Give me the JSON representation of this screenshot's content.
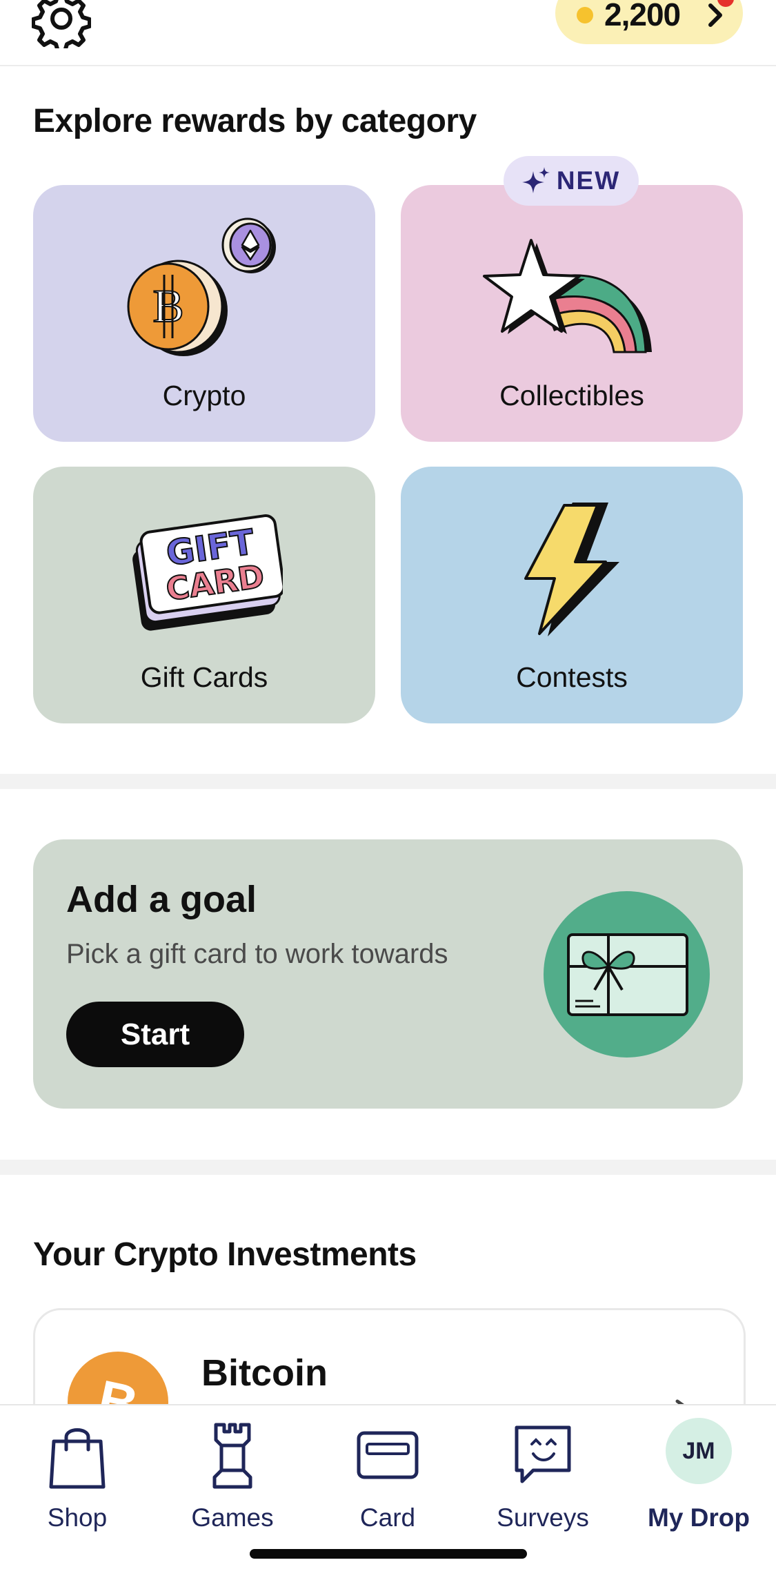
{
  "header": {
    "points": "2,200"
  },
  "categories": {
    "title": "Explore rewards by category",
    "new_badge": "NEW",
    "items": [
      {
        "label": "Crypto",
        "color": "#d4d3ec",
        "icon": "crypto-coins-icon"
      },
      {
        "label": "Collectibles",
        "color": "#ebcade",
        "icon": "shooting-star-icon"
      },
      {
        "label": "Gift Cards",
        "color": "#cfd9cf",
        "icon": "gift-card-icon"
      },
      {
        "label": "Contests",
        "color": "#b5d4e8",
        "icon": "lightning-bolt-icon"
      }
    ],
    "gift_card_art": {
      "line1": "GIFT",
      "line2": "CARD"
    }
  },
  "goal": {
    "title": "Add a goal",
    "subtitle": "Pick a gift card to work towards",
    "button": "Start"
  },
  "investments": {
    "title": "Your Crypto Investments",
    "items": [
      {
        "name": "Bitcoin",
        "icon": "bitcoin-icon"
      }
    ]
  },
  "nav": {
    "items": [
      {
        "label": "Shop",
        "icon": "shopping-bag-icon"
      },
      {
        "label": "Games",
        "icon": "rook-icon"
      },
      {
        "label": "Card",
        "icon": "credit-card-icon"
      },
      {
        "label": "Surveys",
        "icon": "chat-smile-icon"
      },
      {
        "label": "My Drop",
        "icon": "avatar"
      }
    ],
    "avatar_initials": "JM"
  },
  "colors": {
    "accent_points": "#fbf0b6",
    "nav_text": "#1f2659",
    "goal_circle": "#52ad8a"
  }
}
